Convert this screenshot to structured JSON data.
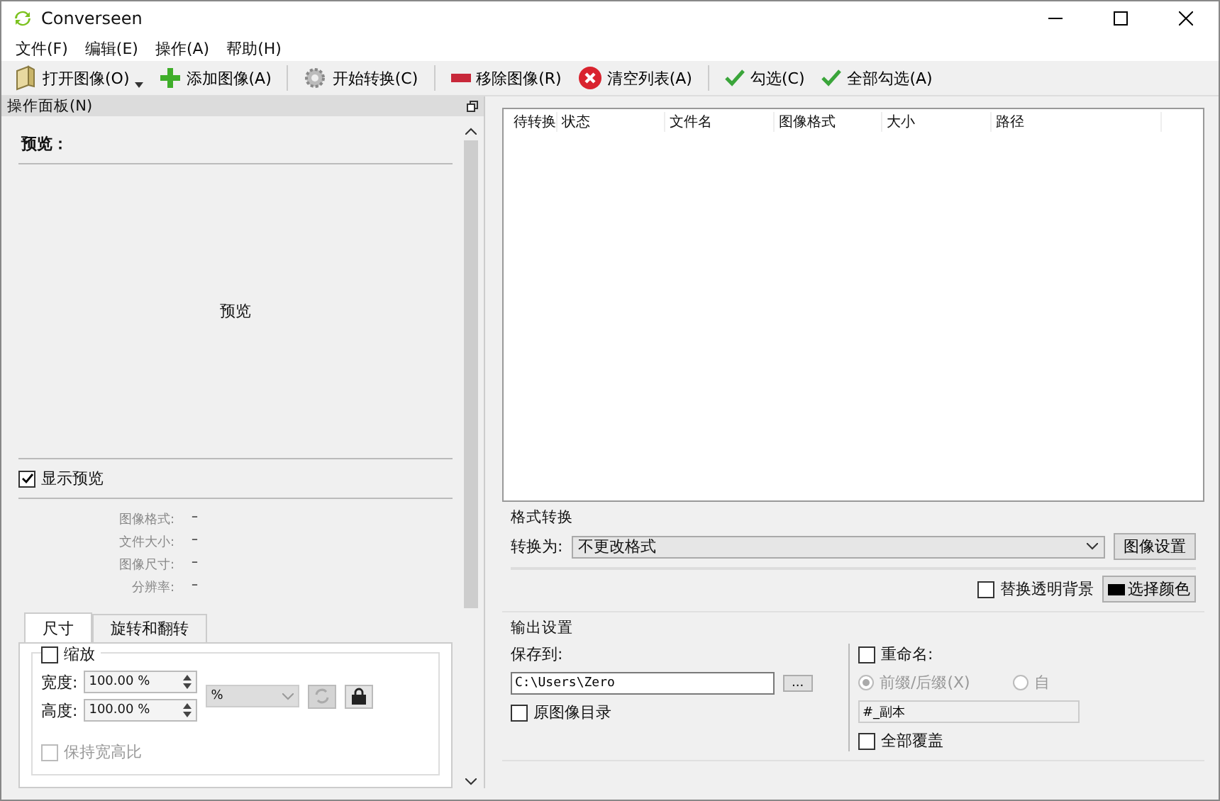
{
  "window": {
    "title": "Converseen"
  },
  "menu": [
    {
      "label": "文件(F)"
    },
    {
      "label": "编辑(E)"
    },
    {
      "label": "操作(A)"
    },
    {
      "label": "帮助(H)"
    }
  ],
  "toolbar": [
    {
      "label": "打开图像(O)",
      "kind": "open",
      "dropdown": true
    },
    {
      "label": "添加图像(A)",
      "kind": "add",
      "dropdown": false
    },
    {
      "label": "开始转换(C)",
      "kind": "convert",
      "dropdown": false
    },
    {
      "label": "移除图像(R)",
      "kind": "remove",
      "dropdown": false
    },
    {
      "label": "清空列表(A)",
      "kind": "clear",
      "dropdown": false
    },
    {
      "label": "勾选(C)",
      "kind": "check",
      "dropdown": false
    },
    {
      "label": "全部勾选(A)",
      "kind": "check",
      "dropdown": false
    }
  ],
  "left_panel": {
    "title": "操作面板(N)",
    "preview_label": "预览：",
    "preview_text": "预览",
    "show_preview": {
      "label": "显示预览",
      "checked": true
    },
    "info": [
      {
        "label": "图像格式:",
        "value": "–"
      },
      {
        "label": "文件大小:",
        "value": "–"
      },
      {
        "label": "图像尺寸:",
        "value": "–"
      },
      {
        "label": "分辨率:",
        "value": "–"
      }
    ],
    "tabs": [
      {
        "label": "尺寸",
        "selected": true
      },
      {
        "label": "旋转和翻转",
        "selected": false
      }
    ],
    "scale": {
      "label": "缩放",
      "checked": false
    },
    "width": {
      "label": "宽度:",
      "value": "100.00 %"
    },
    "height": {
      "label": "高度:",
      "value": "100.00 %"
    },
    "unit": {
      "value": "%"
    },
    "keep_ratio": {
      "label": "保持宽高比",
      "checked": false
    }
  },
  "file_table": {
    "columns": [
      "待转换",
      "状态",
      "文件名",
      "图像格式",
      "大小",
      "路径"
    ]
  },
  "format": {
    "title": "格式转换",
    "convert_label": "转换为:",
    "format_value": "不更改格式",
    "image_settings_button": "图像设置",
    "replace_bg": {
      "label": "替换透明背景",
      "checked": false
    },
    "color_button": "选择颜色"
  },
  "output": {
    "title": "输出设置",
    "save_label": "保存到:",
    "path": "C:\\Users\\Zero",
    "browse_button": "...",
    "original_dir": {
      "label": "原图像目录",
      "checked": false
    },
    "rename": {
      "label": "重命名:",
      "checked": false
    },
    "naming": [
      {
        "label": "前缀/后缀(X)",
        "selected": true
      },
      {
        "label": "自",
        "selected": false
      }
    ],
    "pattern": "#_副本",
    "overwrite_all": {
      "label": "全部覆盖",
      "checked": false
    }
  }
}
